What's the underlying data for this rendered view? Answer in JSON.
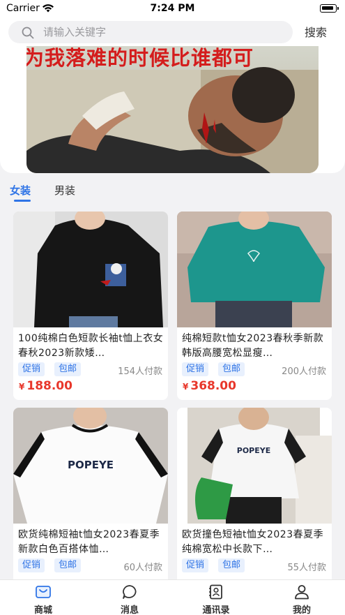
{
  "status_bar": {
    "carrier": "Carrier",
    "time": "7:24 PM"
  },
  "search": {
    "placeholder": "请输入关键字",
    "button_label": "搜索"
  },
  "banner": {
    "headline": "为我落难的时候比谁都可"
  },
  "tabs": [
    {
      "label": "女装",
      "active": true
    },
    {
      "label": "男装",
      "active": false
    }
  ],
  "products": [
    {
      "title": "100纯棉白色短款长袖t恤上衣女春秋2023新款矮…",
      "tags": [
        "促销",
        "包邮"
      ],
      "sales": "154人付款",
      "currency": "¥",
      "price": "188.00"
    },
    {
      "title": "纯棉短款t恤女2023春秋季新款韩版高腰宽松显瘦…",
      "tags": [
        "促销",
        "包邮"
      ],
      "sales": "200人付款",
      "currency": "¥",
      "price": "368.00"
    },
    {
      "title": "欧货纯棉短袖t恤女2023春夏季新款白色百搭体恤…",
      "tags": [
        "促销",
        "包邮"
      ],
      "sales": "60人付款",
      "currency": "¥",
      "price": ""
    },
    {
      "title": "欧货撞色短袖t恤女2023春夏季纯棉宽松中长款下…",
      "tags": [
        "促销",
        "包邮"
      ],
      "sales": "55人付款",
      "currency": "¥",
      "price": ""
    }
  ],
  "bottom_nav": [
    {
      "label": "商城",
      "icon": "shop-icon"
    },
    {
      "label": "消息",
      "icon": "message-icon"
    },
    {
      "label": "通讯录",
      "icon": "contacts-icon"
    },
    {
      "label": "我的",
      "icon": "profile-icon"
    }
  ],
  "colors": {
    "accent": "#2f74e6",
    "price": "#e8372b",
    "tag_bg": "#e8f0fd"
  }
}
